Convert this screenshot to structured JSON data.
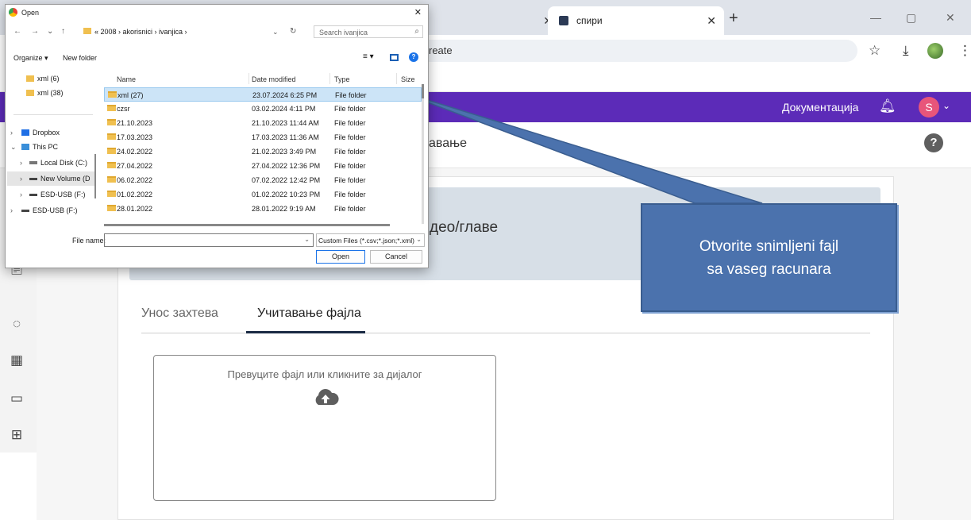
{
  "browser": {
    "active_tab_title": "спири",
    "new_tab_glyph": "+",
    "omnibox_text": "reate",
    "window_controls": {
      "minimize": "—",
      "maximize": "▢",
      "close": "✕"
    }
  },
  "app": {
    "header": {
      "docs_label": "Документација",
      "avatar_letter": "S",
      "accent_color": "#5c2bb8"
    },
    "page_title": "авање",
    "banner_text": "део/главе",
    "tabs": [
      {
        "label": "Унос захтева",
        "active": false
      },
      {
        "label": "Учитавање фајла",
        "active": true
      }
    ],
    "dropzone": {
      "text": "Превуците фајл или кликните за дијалог",
      "icon": "cloud-upload-icon"
    },
    "sidebar_icons": [
      "clipboard-icon",
      "check-circle-icon",
      "calculator-icon",
      "id-card-lock-icon",
      "table-grid-icon"
    ]
  },
  "callout": {
    "line1": "Otvorite snimljeni fajl",
    "line2": "sa vaseg racunara",
    "color": "#4b72ad"
  },
  "dialog": {
    "title": "Open",
    "breadcrumb": "« 2008 › akorisnici › ivanjica ›",
    "search_placeholder": "Search ivanjica",
    "organize_label": "Organize ▾",
    "new_folder_label": "New folder",
    "nav_items": [
      {
        "label": "xml (6)",
        "icon": "folder-icon"
      },
      {
        "label": "xml (38)",
        "icon": "folder-icon"
      },
      {
        "label": "Dropbox",
        "icon": "dropbox-icon"
      },
      {
        "label": "This PC",
        "icon": "pc-icon"
      },
      {
        "label": "Local Disk (C:)",
        "icon": "drive-icon"
      },
      {
        "label": "New Volume (D",
        "icon": "drive-icon"
      },
      {
        "label": "ESD-USB (F:)",
        "icon": "drive-icon"
      },
      {
        "label": "ESD-USB (F:)",
        "icon": "drive-icon"
      }
    ],
    "columns": {
      "name": "Name",
      "date": "Date modified",
      "type": "Type",
      "size": "Size"
    },
    "files": [
      {
        "name": "xml (27)",
        "date": "23.07.2024 6:25 PM",
        "type": "File folder",
        "selected": true
      },
      {
        "name": "czsr",
        "date": "03.02.2024 4:11 PM",
        "type": "File folder",
        "selected": false
      },
      {
        "name": "21.10.2023",
        "date": "21.10.2023 11:44 AM",
        "type": "File folder",
        "selected": false
      },
      {
        "name": "17.03.2023",
        "date": "17.03.2023 11:36 AM",
        "type": "File folder",
        "selected": false
      },
      {
        "name": "24.02.2022",
        "date": "21.02.2023 3:49 PM",
        "type": "File folder",
        "selected": false
      },
      {
        "name": "27.04.2022",
        "date": "27.04.2022 12:36 PM",
        "type": "File folder",
        "selected": false
      },
      {
        "name": "06.02.2022",
        "date": "07.02.2022 12:42 PM",
        "type": "File folder",
        "selected": false
      },
      {
        "name": "01.02.2022",
        "date": "01.02.2022 10:23 PM",
        "type": "File folder",
        "selected": false
      },
      {
        "name": "28.01.2022",
        "date": "28.01.2022 9:19 AM",
        "type": "File folder",
        "selected": false
      }
    ],
    "file_name_label": "File name:",
    "file_name_value": "",
    "file_type_filter": "Custom Files (*.csv;*.json;*.xml)",
    "open_label": "Open",
    "cancel_label": "Cancel"
  }
}
